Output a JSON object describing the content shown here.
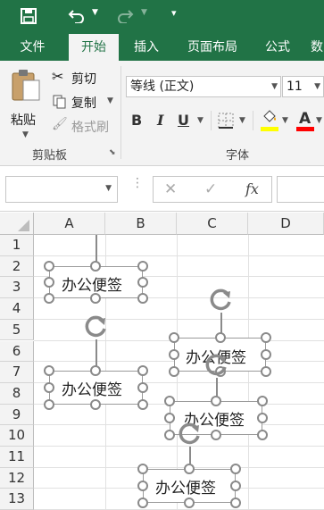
{
  "ribbon_tabs": [
    "文件",
    "开始",
    "插入",
    "页面布局",
    "公式",
    "数"
  ],
  "clipboard": {
    "paste": "粘贴",
    "cut": "剪切",
    "copy": "复制",
    "format_painter": "格式刷",
    "group_label": "剪贴板"
  },
  "font": {
    "name": "等线 (正文)",
    "size": "11",
    "bold": "B",
    "italic": "I",
    "underline": "U",
    "font_color_letter": "A",
    "group_label": "字体"
  },
  "formula_bar": {
    "fx": "fx",
    "cancel": "✕",
    "confirm": "✓"
  },
  "columns": [
    "A",
    "B",
    "C",
    "D"
  ],
  "rows": [
    "1",
    "2",
    "3",
    "4",
    "5",
    "6",
    "7",
    "8",
    "9",
    "10",
    "11",
    "12",
    "13"
  ],
  "notes": [
    {
      "text": "办公便签"
    },
    {
      "text": "办公便签"
    },
    {
      "text": "办公便签"
    },
    {
      "text": "办公便签"
    },
    {
      "text": "办公便签"
    }
  ],
  "colors": {
    "accent": "#217346",
    "highlight": "#ffff00",
    "font_red": "#ff0000"
  }
}
